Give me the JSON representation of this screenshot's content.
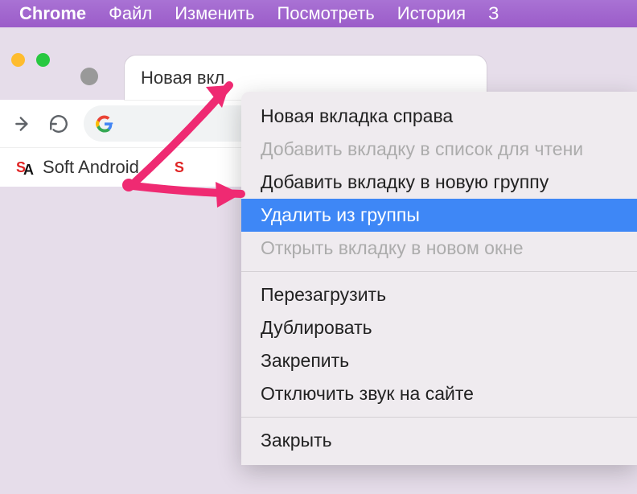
{
  "menubar": {
    "app": "Chrome",
    "items": [
      "Файл",
      "Изменить",
      "Посмотреть",
      "История",
      "З"
    ]
  },
  "tab": {
    "title": "Новая вкл"
  },
  "bookmarks": {
    "item1": "Soft Android"
  },
  "context_menu": {
    "new_tab_right": "Новая вкладка справа",
    "add_to_reading_list": "Добавить вкладку в список для чтени",
    "add_to_new_group": "Добавить вкладку в новую группу",
    "remove_from_group": "Удалить из группы",
    "open_in_new_window": "Открыть вкладку в новом окне",
    "reload": "Перезагрузить",
    "duplicate": "Дублировать",
    "pin": "Закрепить",
    "mute_site": "Отключить звук на сайте",
    "close": "Закрыть"
  }
}
